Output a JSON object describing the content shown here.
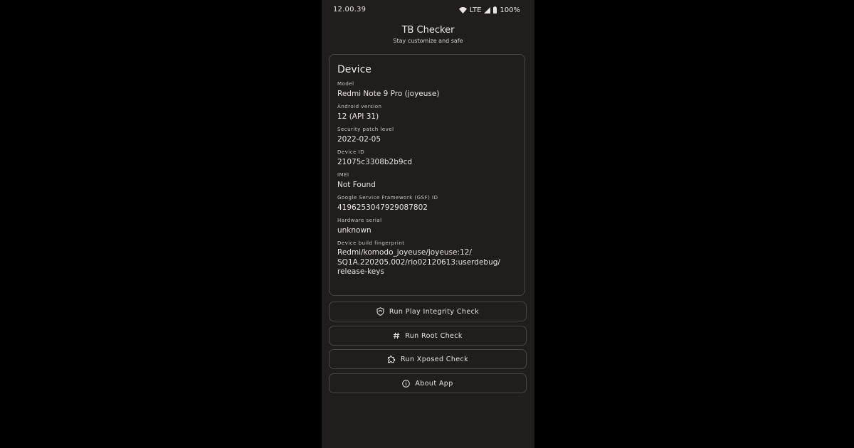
{
  "status_bar": {
    "time": "12.00.39",
    "network": "LTE",
    "battery": "100%",
    "icons": [
      "wifi-icon",
      "signal-icon",
      "battery-icon"
    ]
  },
  "header": {
    "title": "TB Checker",
    "subtitle": "Stay customize and safe"
  },
  "device_card": {
    "title": "Device",
    "fields": [
      {
        "label": "Model",
        "value": "Redmi Note 9 Pro (joyeuse)"
      },
      {
        "label": "Android version",
        "value": "12 (API 31)"
      },
      {
        "label": "Security patch level",
        "value": "2022-02-05"
      },
      {
        "label": "Device ID",
        "value": "21075c3308b2b9cd"
      },
      {
        "label": "IMEI",
        "value": "Not Found"
      },
      {
        "label": "Google Service Framework (GSF) ID",
        "value": "4196253047929087802"
      },
      {
        "label": "Hardware serial",
        "value": "unknown"
      }
    ],
    "fingerprint": {
      "label": "Device build fingerprint",
      "lines": [
        "Redmi/komodo_joyeuse/joyeuse:12/",
        "SQ1A.220205.002/rio02120613:userdebug/",
        "release-keys"
      ]
    }
  },
  "actions": {
    "play_integrity": {
      "label": "Run Play Integrity Check",
      "icon": "shield-icon"
    },
    "root": {
      "label": "Run Root Check",
      "icon": "hash-icon"
    },
    "xposed": {
      "label": "Run Xposed Check",
      "icon": "puzzle-icon"
    },
    "about": {
      "label": "About App",
      "icon": "info-icon"
    }
  },
  "colors": {
    "background": "#000000",
    "surface": "#211d1c",
    "outline": "#4d4442",
    "on_surface": "#ece4e2"
  }
}
